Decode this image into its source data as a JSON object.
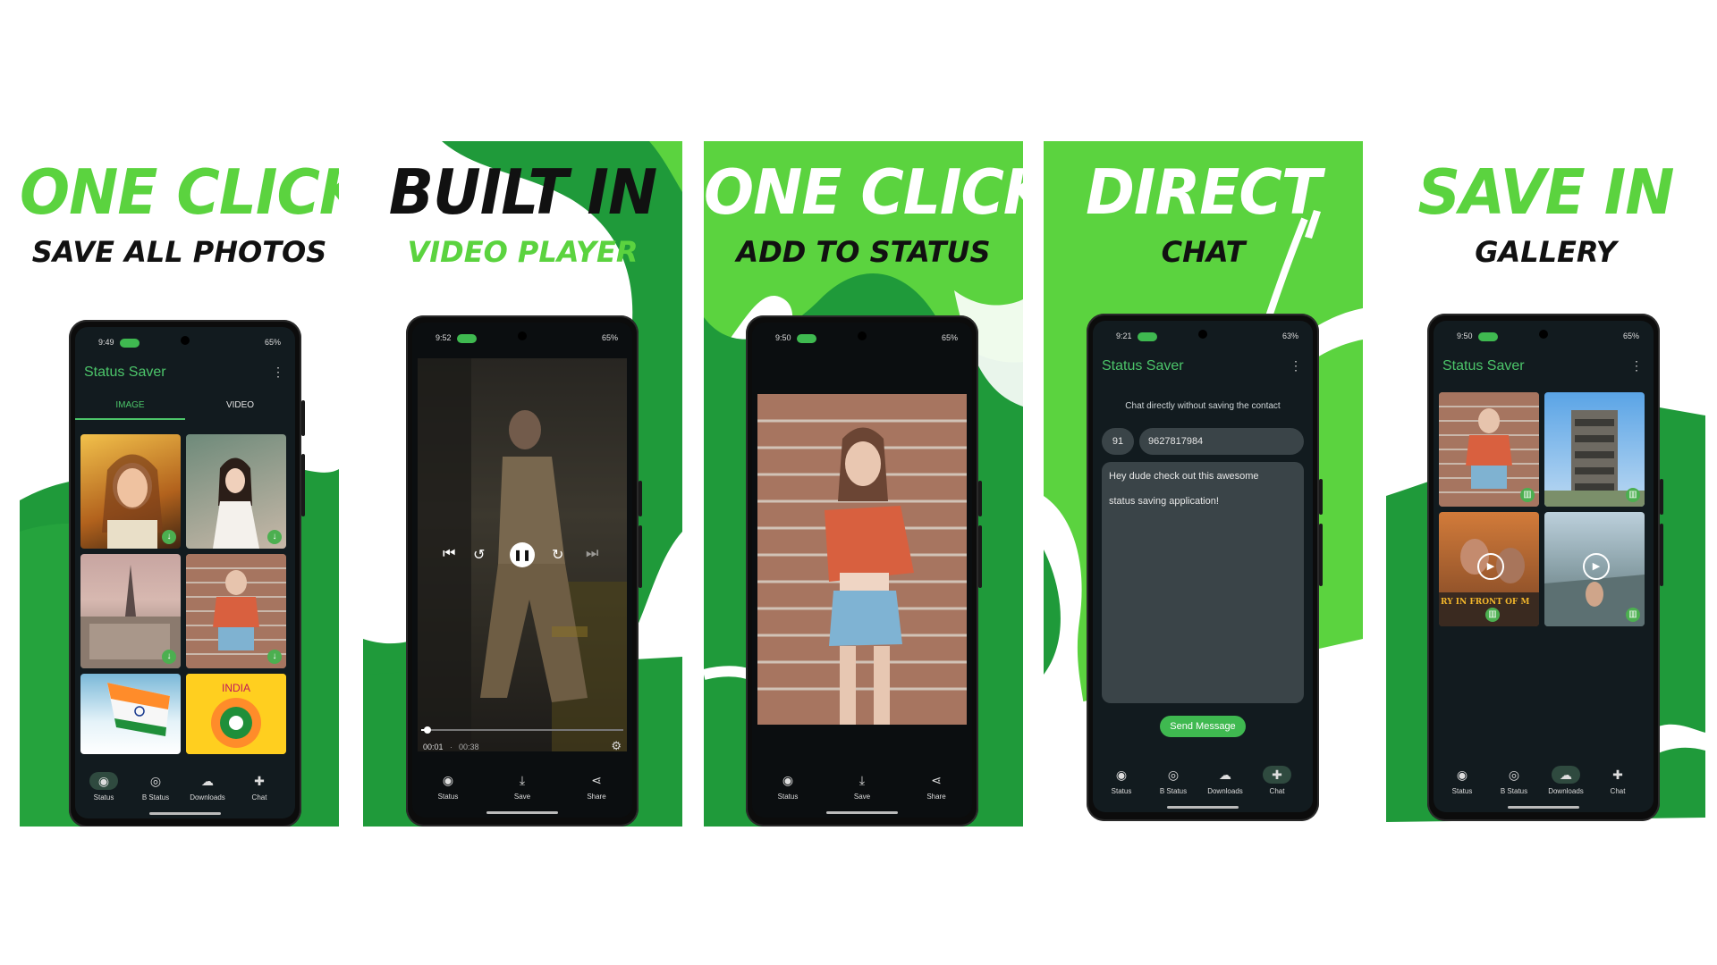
{
  "panels": [
    {
      "headline": "ONE CLICK",
      "subline": "SAVE ALL PHOTOS"
    },
    {
      "headline": "BUILT IN",
      "subline": "VIDEO PLAYER"
    },
    {
      "headline": "ONE CLICK",
      "subline": "ADD TO STATUS"
    },
    {
      "headline": "DIRECT",
      "subline": "CHAT"
    },
    {
      "headline": "SAVE IN",
      "subline": "GALLERY"
    }
  ],
  "app": {
    "title": "Status Saver",
    "tabs": [
      "IMAGE",
      "VIDEO"
    ],
    "nav": [
      "Status",
      "B Status",
      "Downloads",
      "Chat"
    ],
    "player_nav": [
      "Status",
      "Save",
      "Share"
    ]
  },
  "phones": {
    "p1": {
      "time": "9:49",
      "battery": "65%"
    },
    "p2": {
      "time": "9:52",
      "battery": "65%",
      "elapsed": "00:01",
      "duration": "00:38",
      "progress": 0.03
    },
    "p3": {
      "time": "9:50",
      "battery": "65%"
    },
    "p4": {
      "time": "9:21",
      "battery": "63%",
      "hint": "Chat directly without saving the contact",
      "country_code": "91",
      "phone_number": "9627817984",
      "message_line1": "Hey dude check out this awesome",
      "message_line2": "status saving application!",
      "send_label": "Send Message"
    },
    "p5": {
      "time": "9:50",
      "battery": "65%",
      "video_caption": "RY IN FRONT OF M"
    }
  },
  "colors": {
    "brand_green": "#5bd33f",
    "deep_green": "#1f9a3a",
    "app_accent": "#4cc56a",
    "screen_bg": "#121b1f"
  },
  "icons": [
    "whatsapp-status-icon",
    "business-status-icon",
    "cloud-download-icon",
    "chat-icon",
    "download-icon",
    "share-icon",
    "trash-icon",
    "play-icon",
    "pause-icon",
    "previous-icon",
    "next-icon",
    "replay-icon",
    "forward-icon",
    "settings-icon"
  ]
}
